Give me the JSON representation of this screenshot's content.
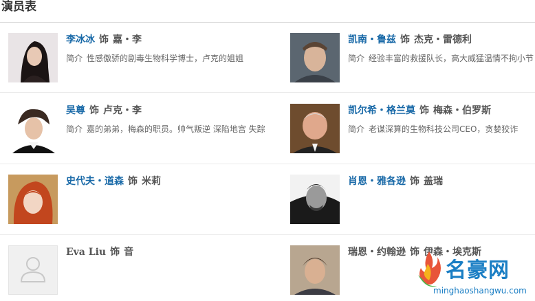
{
  "page": {
    "title": "演员表"
  },
  "cast": [
    {
      "actor": "李冰冰",
      "verb": "饰",
      "role": "嘉・李",
      "desc_label": "简介",
      "desc": "性感傲骄的剧毒生物科学博士，卢克的姐姐",
      "photo_icon": "actor-photo"
    },
    {
      "actor": "凯南・鲁兹",
      "verb": "饰",
      "role": "杰克・雷德利",
      "desc_label": "简介",
      "desc": "经验丰富的救援队长，高大威猛温情不拘小节",
      "photo_icon": "actor-photo"
    },
    {
      "actor": "吴尊",
      "verb": "饰",
      "role": "卢克・李",
      "desc_label": "简介",
      "desc": "嘉的弟弟，梅森的职员。帅气叛逆 深陷地宫 失踪",
      "photo_icon": "actor-photo"
    },
    {
      "actor": "凯尔希・格兰莫",
      "verb": "饰",
      "role": "梅森・伯罗斯",
      "desc_label": "简介",
      "desc": "老谋深算的生物科技公司CEO，贪婪狡诈",
      "photo_icon": "actor-photo"
    },
    {
      "actor": "史代夫・道森",
      "verb": "饰",
      "role": "米莉",
      "desc_label": "",
      "desc": "",
      "photo_icon": "actor-photo"
    },
    {
      "actor": "肖恩・雅各逊",
      "verb": "饰",
      "role": "盖瑞",
      "desc_label": "",
      "desc": "",
      "photo_icon": "actor-photo"
    },
    {
      "actor": "Eva Liu",
      "verb": "饰",
      "role": "音",
      "desc_label": "",
      "desc": "",
      "photo_icon": "user-placeholder-icon"
    },
    {
      "actor": "瑞恩・约翰逊",
      "verb": "饰",
      "role": "伊森・埃克斯",
      "desc_label": "",
      "desc": "",
      "photo_icon": "actor-photo"
    }
  ],
  "watermark": {
    "brand": "名豪网",
    "url": "minghaoshangwu.com"
  },
  "colors": {
    "actor_link": "#1a6aa8",
    "text": "#555555",
    "divider": "#ebebeb",
    "watermark": "#1a7ec4"
  }
}
